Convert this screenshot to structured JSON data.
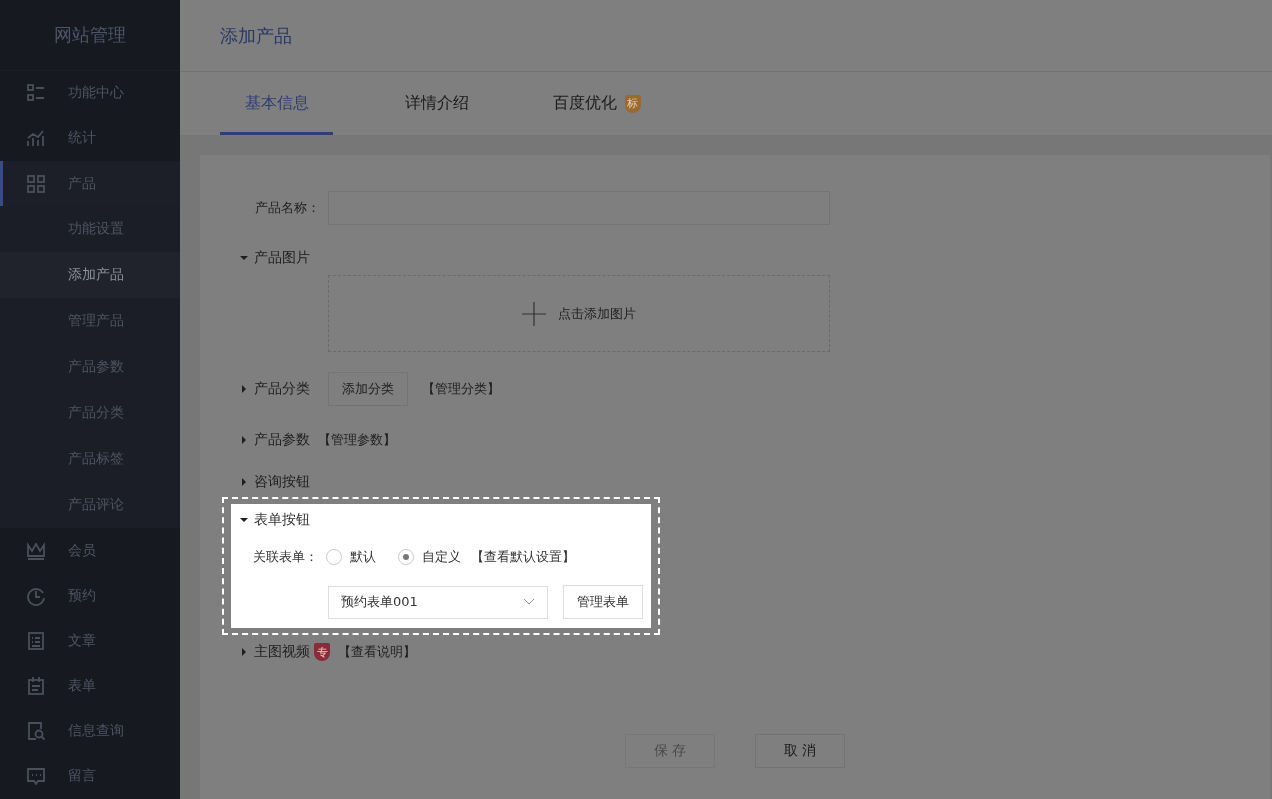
{
  "sidebar": {
    "title": "网站管理",
    "items": [
      {
        "label": "功能中心",
        "selected": false
      },
      {
        "label": "统计",
        "selected": false
      },
      {
        "label": "产品",
        "selected": true,
        "expanded": true,
        "children": [
          {
            "label": "功能设置",
            "selected": false
          },
          {
            "label": "添加产品",
            "selected": true
          },
          {
            "label": "管理产品",
            "selected": false
          },
          {
            "label": "产品参数",
            "selected": false
          },
          {
            "label": "产品分类",
            "selected": false
          },
          {
            "label": "产品标签",
            "selected": false
          },
          {
            "label": "产品评论",
            "selected": false
          }
        ]
      },
      {
        "label": "会员",
        "selected": false
      },
      {
        "label": "预约",
        "selected": false
      },
      {
        "label": "文章",
        "selected": false
      },
      {
        "label": "表单",
        "selected": false
      },
      {
        "label": "信息查询",
        "selected": false
      },
      {
        "label": "留言",
        "selected": false
      }
    ]
  },
  "page_title": "添加产品",
  "tabs": [
    {
      "label": "基本信息",
      "selected": true
    },
    {
      "label": "详情介绍",
      "selected": false
    },
    {
      "label": "百度优化",
      "selected": false,
      "badge": "标"
    }
  ],
  "name_field": {
    "label": "产品名称："
  },
  "sections": [
    {
      "kind": "upload",
      "title": "产品图片",
      "expanded": true,
      "upload_label": "点击添加图片"
    },
    {
      "kind": "category",
      "title": "产品分类",
      "expanded": false,
      "button": "添加分类",
      "link": "【管理分类】"
    },
    {
      "kind": "link",
      "title": "产品参数",
      "expanded": false,
      "link": "【管理参数】"
    },
    {
      "kind": "plain",
      "title": "咨询按钮",
      "expanded": false
    },
    {
      "kind": "form",
      "title": "表单按钮",
      "expanded": true,
      "field_label": "关联表单：",
      "options": [
        {
          "label": "默认",
          "selected": false
        },
        {
          "label": "自定义",
          "selected": true
        }
      ],
      "link": "【查看默认设置】",
      "select_value": "预约表单001",
      "button": "管理表单"
    },
    {
      "kind": "link",
      "title": "主图视频",
      "expanded": false,
      "badge": "专",
      "link": "【查看说明】"
    }
  ],
  "footer": [
    {
      "label": "保 存",
      "disabled": true
    },
    {
      "label": "取 消",
      "disabled": false
    }
  ]
}
